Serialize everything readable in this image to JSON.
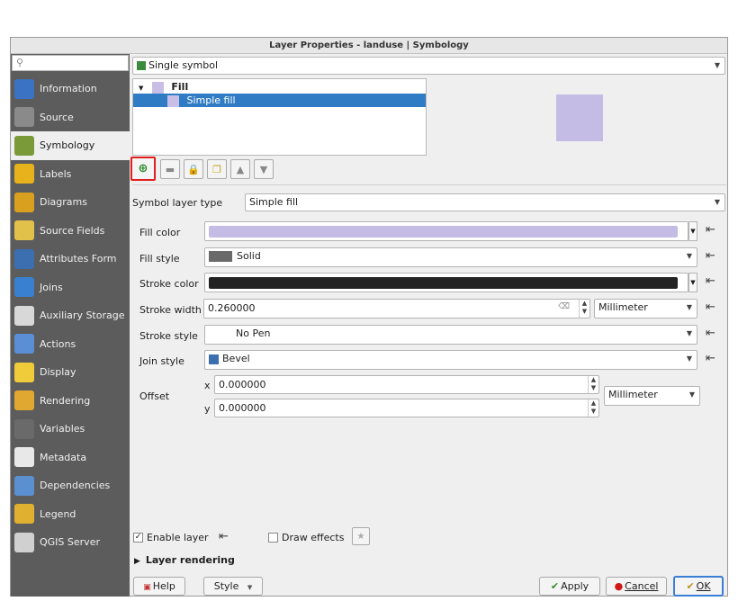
{
  "window": {
    "title": "Layer Properties - landuse | Symbology"
  },
  "sidebar": {
    "search_icon": "search-icon",
    "items": [
      {
        "label": "Information",
        "icon": "info-icon",
        "color": "#3a73c4"
      },
      {
        "label": "Source",
        "icon": "wrench-icon",
        "color": "#8a8a8a"
      },
      {
        "label": "Symbology",
        "icon": "paintbrush-icon",
        "color": "#7a9a3a"
      },
      {
        "label": "Labels",
        "icon": "abc-label-icon",
        "color": "#e8b21c"
      },
      {
        "label": "Diagrams",
        "icon": "diagram-icon",
        "color": "#d9a020"
      },
      {
        "label": "Source Fields",
        "icon": "fields-icon",
        "color": "#e2c14a"
      },
      {
        "label": "Attributes Form",
        "icon": "form-icon",
        "color": "#3b6fb0"
      },
      {
        "label": "Joins",
        "icon": "joins-icon",
        "color": "#3a80d0"
      },
      {
        "label": "Auxiliary Storage",
        "icon": "storage-icon",
        "color": "#d8d8d8"
      },
      {
        "label": "Actions",
        "icon": "actions-icon",
        "color": "#5a8fd6"
      },
      {
        "label": "Display",
        "icon": "display-icon",
        "color": "#f1cc3a"
      },
      {
        "label": "Rendering",
        "icon": "rendering-icon",
        "color": "#e0a830"
      },
      {
        "label": "Variables",
        "icon": "variables-icon",
        "color": "#6a6a6a"
      },
      {
        "label": "Metadata",
        "icon": "metadata-icon",
        "color": "#e8e8e8"
      },
      {
        "label": "Dependencies",
        "icon": "dependencies-icon",
        "color": "#5a90d0"
      },
      {
        "label": "Legend",
        "icon": "legend-icon",
        "color": "#e0b030"
      },
      {
        "label": "QGIS Server",
        "icon": "server-icon",
        "color": "#d0d0d0"
      }
    ],
    "active_index": 2
  },
  "renderer": {
    "value": "Single symbol"
  },
  "tree": {
    "root": "Fill",
    "child": "Simple fill"
  },
  "symbol_layer_type": {
    "label": "Symbol layer type",
    "value": "Simple fill"
  },
  "fill_color": {
    "label": "Fill color",
    "color": "#c4bce4"
  },
  "fill_style": {
    "label": "Fill style",
    "value": "Solid"
  },
  "stroke_color": {
    "label": "Stroke color",
    "color": "#232323"
  },
  "stroke_width": {
    "label": "Stroke width",
    "value": "0.260000",
    "unit": "Millimeter"
  },
  "stroke_style": {
    "label": "Stroke style",
    "value": "No Pen"
  },
  "join_style": {
    "label": "Join style",
    "value": "Bevel"
  },
  "offset": {
    "label": "Offset",
    "x_label": "x",
    "x_value": "0.000000",
    "y_label": "y",
    "y_value": "0.000000",
    "unit": "Millimeter"
  },
  "enable_layer": {
    "label": "Enable layer",
    "checked": true
  },
  "draw_effects": {
    "label": "Draw effects",
    "checked": false
  },
  "layer_rendering": {
    "label": "Layer rendering"
  },
  "buttons": {
    "help": "Help",
    "style": "Style",
    "apply": "Apply",
    "cancel": "Cancel",
    "ok": "OK"
  }
}
